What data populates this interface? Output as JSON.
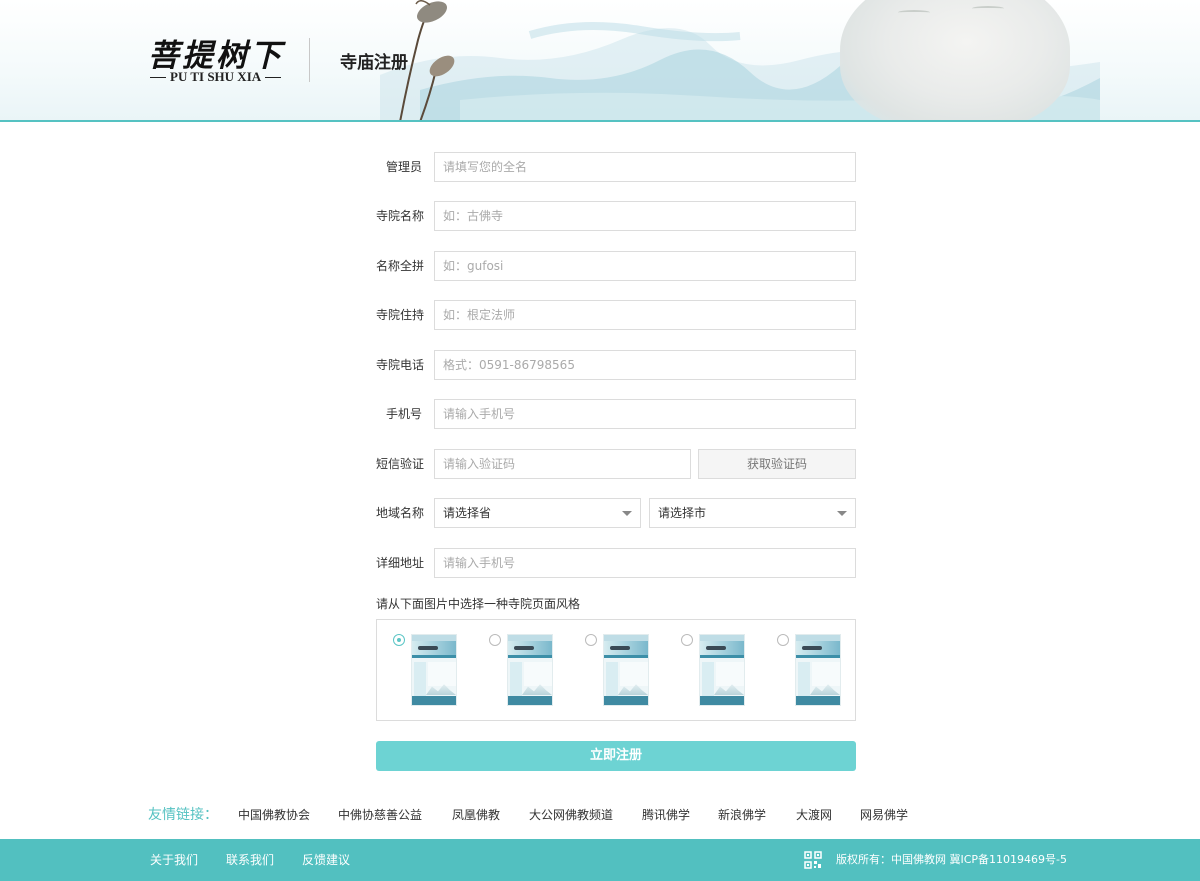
{
  "header": {
    "logo_cn": "菩提树下",
    "logo_en": "PU TI SHU XIA",
    "page_title": "寺庙注册"
  },
  "form": {
    "fields": [
      {
        "label": "管理员",
        "placeholder": "请填写您的全名"
      },
      {
        "label": "寺院名称",
        "placeholder": "如：古佛寺"
      },
      {
        "label": "名称全拼",
        "placeholder": "如：gufosi"
      },
      {
        "label": "寺院住持",
        "placeholder": "如：根定法师"
      },
      {
        "label": "寺院电话",
        "placeholder": "格式：0591-86798565"
      },
      {
        "label": "手机号",
        "placeholder": "请输入手机号"
      }
    ],
    "sms": {
      "label": "短信验证",
      "placeholder": "请输入验证码",
      "button": "获取验证码"
    },
    "region": {
      "label": "地域名称",
      "province": "请选择省",
      "city": "请选择市"
    },
    "address": {
      "label": "详细地址",
      "placeholder": "请输入手机号"
    },
    "style_prompt": "请从下面图片中选择一种寺院页面风格",
    "style_options": [
      {
        "selected": true
      },
      {
        "selected": false
      },
      {
        "selected": false
      },
      {
        "selected": false
      },
      {
        "selected": false
      }
    ],
    "submit": "立即注册"
  },
  "friend_links": {
    "title": "友情链接：",
    "items": [
      "中国佛教协会",
      "中佛协慈善公益",
      "凤凰佛教",
      "大公网佛教频道",
      "腾讯佛学",
      "新浪佛学",
      "大渡网",
      "网易佛学"
    ]
  },
  "footer": {
    "links": [
      "关于我们",
      "联系我们",
      "反馈建议"
    ],
    "copyright": "版权所有：中国佛教网 冀ICP备11019469号-5"
  },
  "colors": {
    "accent": "#52c0c0",
    "submit": "#6dd3d3",
    "link_title": "#55c2c2"
  }
}
